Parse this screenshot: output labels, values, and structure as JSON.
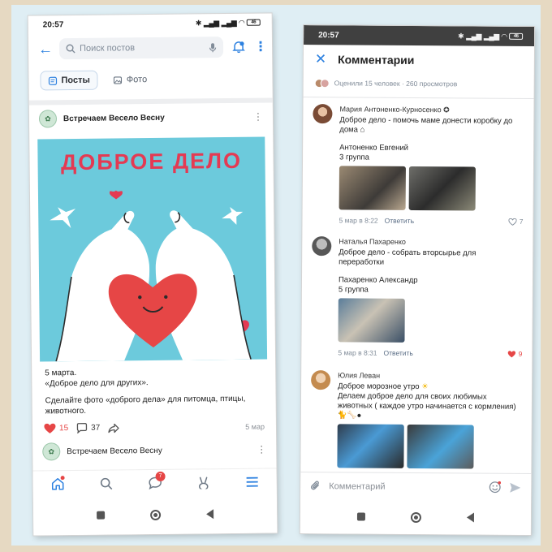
{
  "colors": {
    "accent": "#2d81e0",
    "like_red": "#e64646",
    "image_bg": "#6ccadc",
    "headline": "#e43a53"
  },
  "left_phone": {
    "status": {
      "time": "20:57",
      "battery": "46"
    },
    "search": {
      "placeholder": "Поиск постов"
    },
    "tabs": [
      {
        "label": "Посты",
        "icon": "document-icon",
        "active": true
      },
      {
        "label": "Фото",
        "icon": "image-icon",
        "active": false
      }
    ],
    "post": {
      "group_name": "Встречаем Весело Весну",
      "image_headline": "ДОБРОЕ ДЕЛО",
      "line1": "5 марта.",
      "line2": "«Доброе дело для других».",
      "line3": "Сделайте фото «доброго дела» для питомца, птицы, животного.",
      "likes": "15",
      "comments": "37",
      "date": "5 мар"
    },
    "next_post": {
      "group_name": "Встречаем Весело Весну"
    },
    "bottom_nav": {
      "messages_badge": "7",
      "items": [
        "home-icon",
        "search-icon",
        "messages-icon",
        "services-icon",
        "menu-icon"
      ]
    }
  },
  "right_phone": {
    "status": {
      "time": "20:57",
      "battery": "46"
    },
    "header": {
      "title": "Комментарии"
    },
    "stats": "Оценили 15 человек · 260 просмотров",
    "comments": [
      {
        "name": "Мария Антоненко-Курносенко",
        "text": "Доброе дело - помочь маме донести коробку до дома",
        "sub_name": "Антоненко Евгений",
        "sub_group": "3 группа",
        "date": "5 мар в 8:22",
        "reply": "Ответить",
        "likes": "7",
        "liked": false
      },
      {
        "name": "Наталья Пахаренко",
        "text": "Доброе дело - собрать вторсырье для переработки",
        "sub_name": "Пахаренко Александр",
        "sub_group": "5 группа",
        "date": "5 мар в 8:31",
        "reply": "Ответить",
        "likes": "9",
        "liked": true
      },
      {
        "name": "Юлия Леван",
        "line1": "Доброе морозное утро",
        "line2": "Делаем доброе дело для своих любимых животных ( каждое утро начинается с кормления)"
      }
    ],
    "input": {
      "placeholder": "Комментарий"
    }
  }
}
